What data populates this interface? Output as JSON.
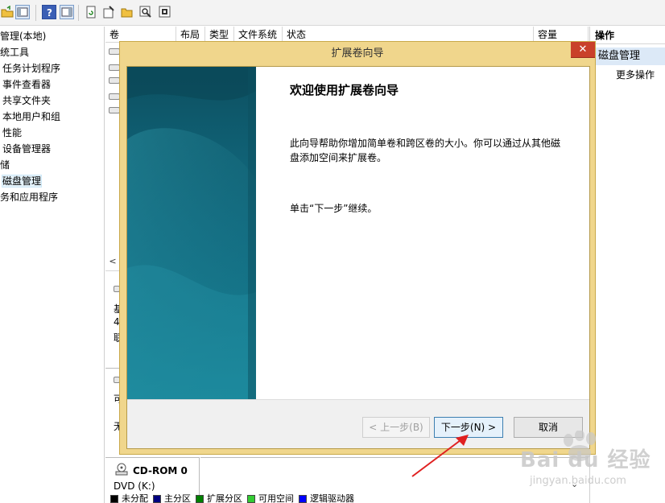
{
  "tree": {
    "items": [
      "管理(本地)",
      "统工具",
      "任务计划程序",
      "事件查看器",
      "共享文件夹",
      "本地用户和组",
      "性能",
      "设备管理器",
      "储",
      "磁盘管理",
      "务和应用程序"
    ]
  },
  "volume_table": {
    "columns": [
      "卷",
      "布局",
      "类型",
      "文件系统",
      "状态",
      "容量"
    ]
  },
  "lower_pane": {
    "partial_labels": [
      "基",
      "4",
      "联",
      "可",
      "无"
    ],
    "cdrom_name": "CD-ROM 0",
    "cdrom_drive": "DVD (K:)"
  },
  "legend": {
    "items": [
      {
        "label": "未分配",
        "color": "#000000"
      },
      {
        "label": "主分区",
        "color": "#000080"
      },
      {
        "label": "扩展分区",
        "color": "#008000"
      },
      {
        "label": "可用空间",
        "color": "#33cc33"
      },
      {
        "label": "逻辑驱动器",
        "color": "#0000ff"
      }
    ]
  },
  "actions": {
    "title": "操作",
    "section": "磁盘管理",
    "more": "更多操作"
  },
  "dialog": {
    "title": "扩展卷向导",
    "close_glyph": "✕",
    "heading": "欢迎使用扩展卷向导",
    "body": "此向导帮助你增加简单卷和跨区卷的大小。你可以通过从其他磁盘添加空间来扩展卷。",
    "hint": "单击“下一步”继续。",
    "buttons": {
      "back": "< 上一步(B)",
      "next": "下一步(N) >",
      "cancel": "取消"
    }
  },
  "watermark": {
    "brand": "Bai du 经验",
    "url": "jingyan.baidu.com"
  },
  "colors": {
    "dialog_frame": "#f0d68c",
    "close_button": "#c9402a",
    "banner_teal": "#1a7a8c",
    "annotation_arrow": "#e02020"
  }
}
